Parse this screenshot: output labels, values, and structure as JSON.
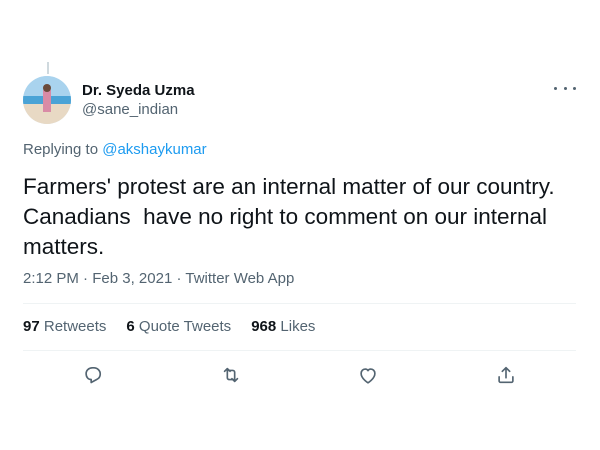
{
  "tweet": {
    "author": {
      "name": "Dr. Syeda Uzma",
      "handle": "@sane_indian"
    },
    "replying_to": {
      "prefix": "Replying to",
      "mention": "@akshaykumar"
    },
    "text": "Farmers' protest are an internal matter of our country. Canadians  have no right to comment on our internal matters.",
    "time": "2:12 PM",
    "separator": "·",
    "date": "Feb 3, 2021",
    "source": "Twitter Web App"
  },
  "stats": {
    "retweets_count": "97",
    "retweets_label": "Retweets",
    "quotes_count": "6",
    "quotes_label": "Quote Tweets",
    "likes_count": "968",
    "likes_label": "Likes"
  },
  "actions": [
    "reply-icon",
    "retweet-icon",
    "like-icon",
    "share-icon"
  ],
  "colors": {
    "text": "#0f1419",
    "secondary": "#536471",
    "link": "#1d9bf0",
    "divider": "#eff3f4"
  }
}
